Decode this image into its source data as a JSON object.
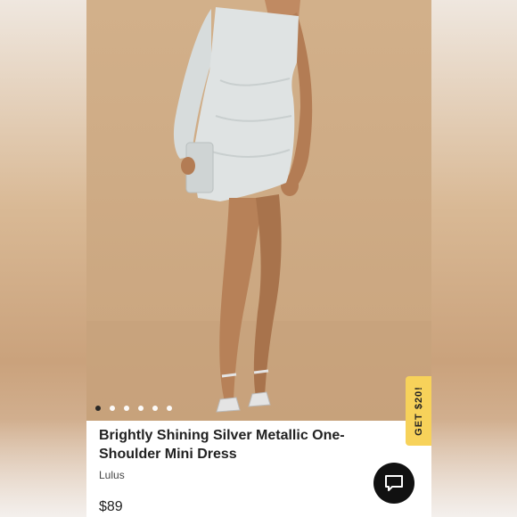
{
  "product": {
    "title": "Brightly Shining Silver Metallic One-Shoulder Mini Dress",
    "brand": "Lulus",
    "price": "$89"
  },
  "carousel": {
    "image_count": 6,
    "active_index": 0
  },
  "promo": {
    "label": "GET $20!"
  },
  "icons": {
    "chat": "chat-bubble-icon"
  },
  "colors": {
    "promo_tab": "#f7d25a",
    "chat_button": "#111111",
    "backdrop": "#ceab85"
  }
}
